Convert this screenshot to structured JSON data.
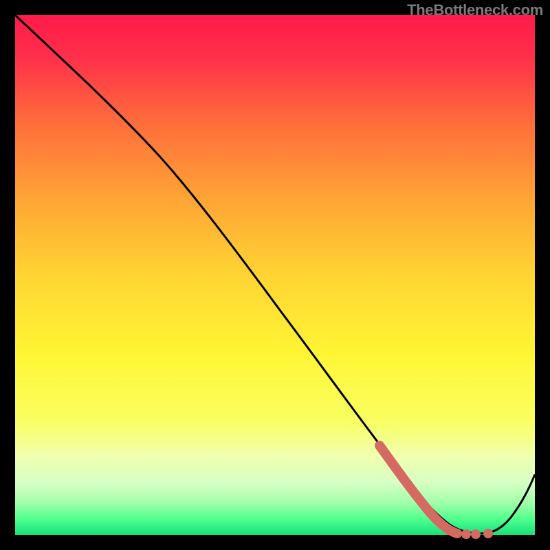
{
  "watermark": "TheBottleneck.com",
  "chart_data": {
    "type": "line",
    "title": "",
    "xlabel": "",
    "ylabel": "",
    "xlim": [
      0,
      100
    ],
    "ylim": [
      0,
      100
    ],
    "grid": false,
    "legend": false,
    "gradient_stops": [
      {
        "offset": 0.0,
        "color": "#ff1a4a"
      },
      {
        "offset": 0.08,
        "color": "#ff2f4a"
      },
      {
        "offset": 0.2,
        "color": "#ff6a3c"
      },
      {
        "offset": 0.35,
        "color": "#ffa335"
      },
      {
        "offset": 0.5,
        "color": "#ffd433"
      },
      {
        "offset": 0.65,
        "color": "#fff534"
      },
      {
        "offset": 0.78,
        "color": "#f9ff60"
      },
      {
        "offset": 0.85,
        "color": "#f0ffb0"
      },
      {
        "offset": 0.9,
        "color": "#d6ffc4"
      },
      {
        "offset": 0.94,
        "color": "#9effa9"
      },
      {
        "offset": 0.97,
        "color": "#4eff8e"
      },
      {
        "offset": 1.0,
        "color": "#16e07a"
      }
    ],
    "series": [
      {
        "name": "bottleneck-curve",
        "x": [
          0,
          8,
          18,
          28,
          40,
          52,
          62,
          70,
          76,
          80,
          84,
          88,
          92,
          96,
          100
        ],
        "y": [
          100,
          92,
          83,
          72,
          58,
          44,
          31,
          19,
          10,
          3,
          1,
          1,
          3,
          10,
          18
        ]
      }
    ],
    "highlight": {
      "name": "optimal-range",
      "x": [
        70,
        74,
        78,
        80,
        83,
        85,
        87
      ],
      "y": [
        19,
        12,
        6,
        3,
        1,
        1,
        1
      ],
      "color": "#d46a62",
      "style": "thick-then-dotted"
    }
  }
}
